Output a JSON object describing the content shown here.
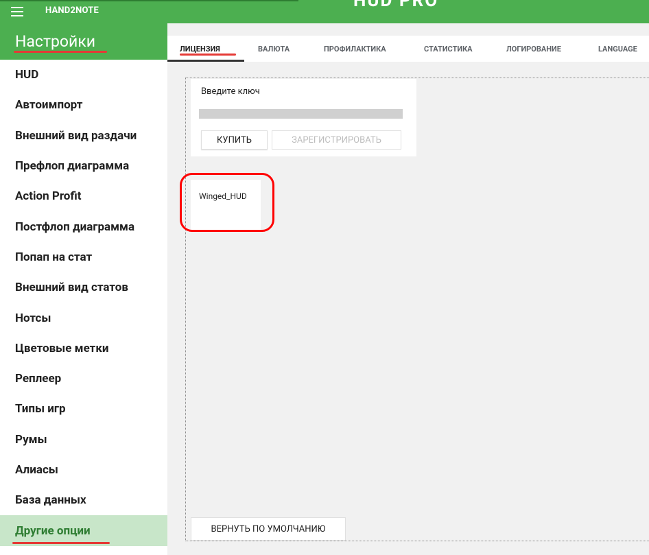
{
  "app": {
    "title": "HAND2NOTE",
    "header_cutoff": "HUD PRO"
  },
  "sidebar": {
    "title": "Настройки",
    "items": [
      {
        "label": "HUD",
        "active": false
      },
      {
        "label": "Автоимпорт",
        "active": false
      },
      {
        "label": "Внешний вид раздачи",
        "active": false
      },
      {
        "label": "Префлоп диаграмма",
        "active": false
      },
      {
        "label": "Action Profit",
        "active": false
      },
      {
        "label": "Постфлоп диаграмма",
        "active": false
      },
      {
        "label": "Попап на стат",
        "active": false
      },
      {
        "label": "Внешний вид статов",
        "active": false
      },
      {
        "label": "Нотсы",
        "active": false
      },
      {
        "label": "Цветовые метки",
        "active": false
      },
      {
        "label": "Реплеер",
        "active": false
      },
      {
        "label": "Типы игр",
        "active": false
      },
      {
        "label": "Румы",
        "active": false
      },
      {
        "label": "Алиасы",
        "active": false
      },
      {
        "label": "База данных",
        "active": false
      },
      {
        "label": "Другие опции",
        "active": true
      }
    ]
  },
  "tabs": [
    {
      "label": "ЛИЦЕНЗИЯ",
      "active": true
    },
    {
      "label": "ВАЛЮТА",
      "active": false
    },
    {
      "label": "ПРОФИЛАКТИКА",
      "active": false
    },
    {
      "label": "СТАТИСТИКА",
      "active": false
    },
    {
      "label": "ЛОГИРОВАНИЕ",
      "active": false
    },
    {
      "label": "LANGUAGE",
      "active": false
    }
  ],
  "license": {
    "key_label": "Введите ключ",
    "key_value": "••••••••••••••••••••",
    "buy_label": "КУПИТЬ",
    "register_label": "ЗАРЕГИСТРИРОВАТЬ",
    "license_name": "Winged_HUD"
  },
  "footer": {
    "reset_label": "ВЕРНУТЬ ПО УМОЛЧАНИЮ"
  },
  "colors": {
    "brand_green": "#4caf50",
    "active_item_bg": "#c8e6c9",
    "active_item_text": "#2e7d32",
    "annotation_red": "#ff0000"
  }
}
